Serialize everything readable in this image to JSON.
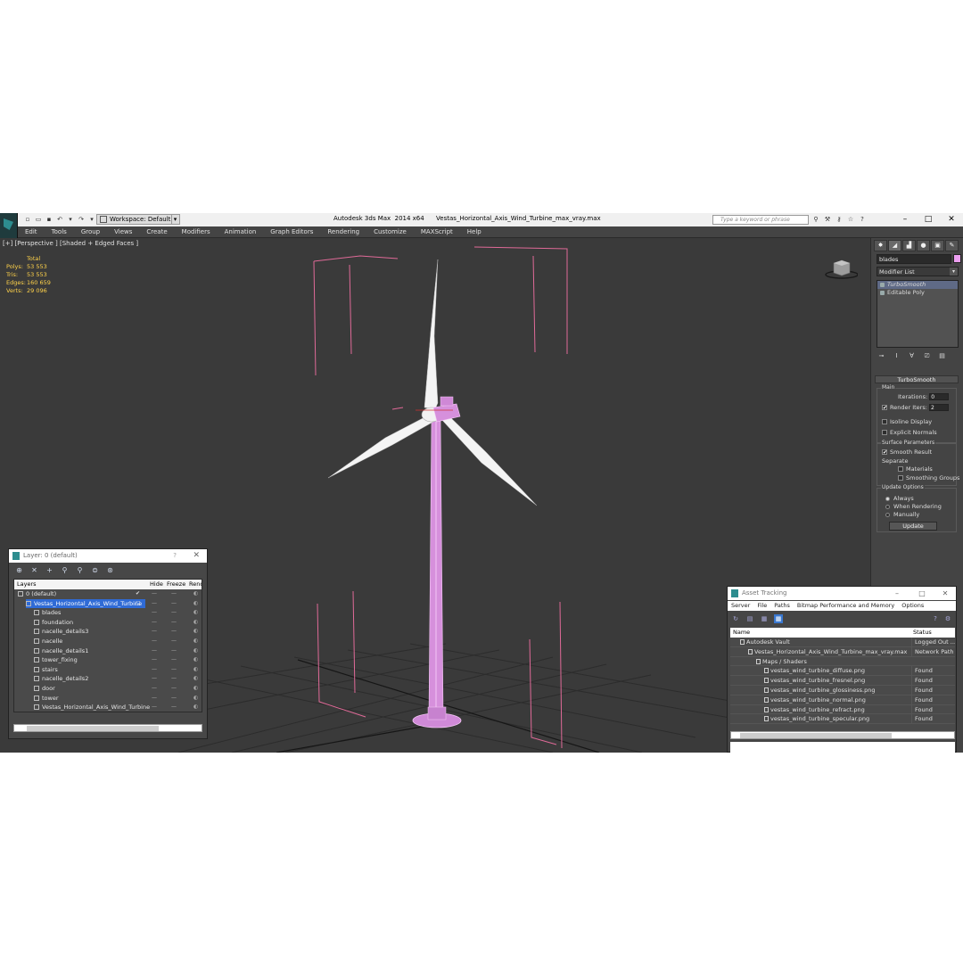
{
  "titlebar": {
    "title": "Autodesk 3ds Max  2014 x64      Vestas_Horizontal_Axis_Wind_Turbine_max_vray.max",
    "workspace": "Workspace: Default",
    "search_placeholder": "Type a keyword or phrase",
    "minimize": "–",
    "maximize": "□",
    "close": "✕"
  },
  "menu": [
    "Edit",
    "Tools",
    "Group",
    "Views",
    "Create",
    "Modifiers",
    "Animation",
    "Graph Editors",
    "Rendering",
    "Customize",
    "MAXScript",
    "Help"
  ],
  "viewport": {
    "label": "[+] [Perspective ] [Shaded + Edged Faces ]",
    "stats": {
      "header": "Total",
      "rows": [
        {
          "label": "Polys:",
          "value": "53 553"
        },
        {
          "label": "Tris:",
          "value": "53 553"
        },
        {
          "label": "Edges:",
          "value": "160 659"
        },
        {
          "label": "Verts:",
          "value": "29 096"
        }
      ]
    }
  },
  "command_panel": {
    "object_name": "blades",
    "object_color": "#ec9ff0",
    "modifier_list": "Modifier List",
    "stack": [
      "TurboSmooth",
      "Editable Poly"
    ],
    "rollout_title": "TurboSmooth",
    "main_group": "Main",
    "iterations_label": "Iterations:",
    "iterations_value": "0",
    "render_iters_label": "Render Iters:",
    "render_iters_value": "2",
    "isoline_display": "Isoline Display",
    "explicit_normals": "Explicit Normals",
    "surface_params": "Surface Parameters",
    "smooth_result": "Smooth Result",
    "separate": "Separate",
    "materials": "Materials",
    "smoothing_groups": "Smoothing Groups",
    "update_options": "Update Options",
    "always": "Always",
    "when_rendering": "When Rendering",
    "manually": "Manually",
    "update_button": "Update"
  },
  "layer_window": {
    "title": "Layer: 0 (default)",
    "help": "?",
    "close": "✕",
    "columns": [
      "Layers",
      "Hide",
      "Freeze",
      "Rende"
    ],
    "rows": [
      {
        "name": "0 (default)",
        "indent": 0
      },
      {
        "name": "Vestas_Horizontal_Axis_Wind_Turbine",
        "indent": 1
      },
      {
        "name": "blades",
        "indent": 2
      },
      {
        "name": "foundation",
        "indent": 2
      },
      {
        "name": "nacelle_details3",
        "indent": 2
      },
      {
        "name": "nacelle",
        "indent": 2
      },
      {
        "name": "nacelle_details1",
        "indent": 2
      },
      {
        "name": "tower_fixing",
        "indent": 2
      },
      {
        "name": "stairs",
        "indent": 2
      },
      {
        "name": "nacelle_details2",
        "indent": 2
      },
      {
        "name": "door",
        "indent": 2
      },
      {
        "name": "tower",
        "indent": 2
      },
      {
        "name": "Vestas_Horizontal_Axis_Wind_Turbine",
        "indent": 2
      }
    ]
  },
  "asset_window": {
    "title": "Asset Tracking",
    "menu": [
      "Server",
      "File",
      "Paths",
      "Bitmap Performance and Memory",
      "Options"
    ],
    "columns": [
      "Name",
      "Status"
    ],
    "rows": [
      {
        "name": "Autodesk Vault",
        "status": "Logged Out ...",
        "indent": 1
      },
      {
        "name": "Vestas_Horizontal_Axis_Wind_Turbine_max_vray.max",
        "status": "Network Path",
        "indent": 2
      },
      {
        "name": "Maps / Shaders",
        "status": "",
        "indent": 3
      },
      {
        "name": "vestas_wind_turbine_diffuse.png",
        "status": "Found",
        "indent": 4
      },
      {
        "name": "vestas_wind_turbine_fresnel.png",
        "status": "Found",
        "indent": 4
      },
      {
        "name": "vestas_wind_turbine_glossiness.png",
        "status": "Found",
        "indent": 4
      },
      {
        "name": "vestas_wind_turbine_normal.png",
        "status": "Found",
        "indent": 4
      },
      {
        "name": "vestas_wind_turbine_refract.png",
        "status": "Found",
        "indent": 4
      },
      {
        "name": "vestas_wind_turbine_specular.png",
        "status": "Found",
        "indent": 4
      }
    ]
  }
}
